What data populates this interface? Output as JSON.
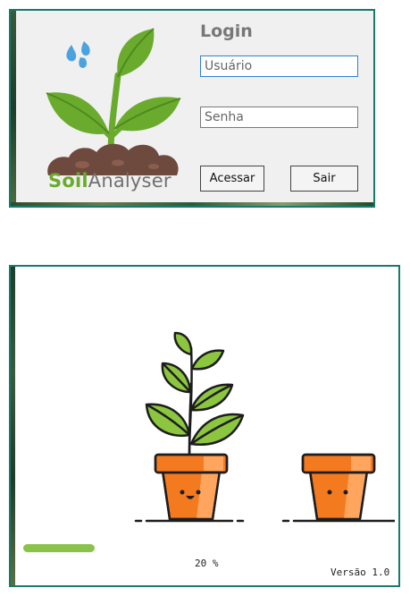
{
  "login": {
    "title": "Login",
    "username_value": "Usuário",
    "password_placeholder": "Senha",
    "enter_button": "Acessar",
    "exit_button": "Sair",
    "brand_bold": "Soil",
    "brand_rest": "Analyser"
  },
  "splash": {
    "progress_percent": 20,
    "progress_text": "20 %",
    "version": "Versão 1.0"
  },
  "colors": {
    "window_border": "#167a6c",
    "brand_green": "#6aab2d",
    "progress_green": "#8bc34a",
    "pot_orange": "#f47a20"
  },
  "icons": [
    "plant-logo-icon",
    "water-drop-icon",
    "potted-plant-icon",
    "empty-pot-icon"
  ]
}
